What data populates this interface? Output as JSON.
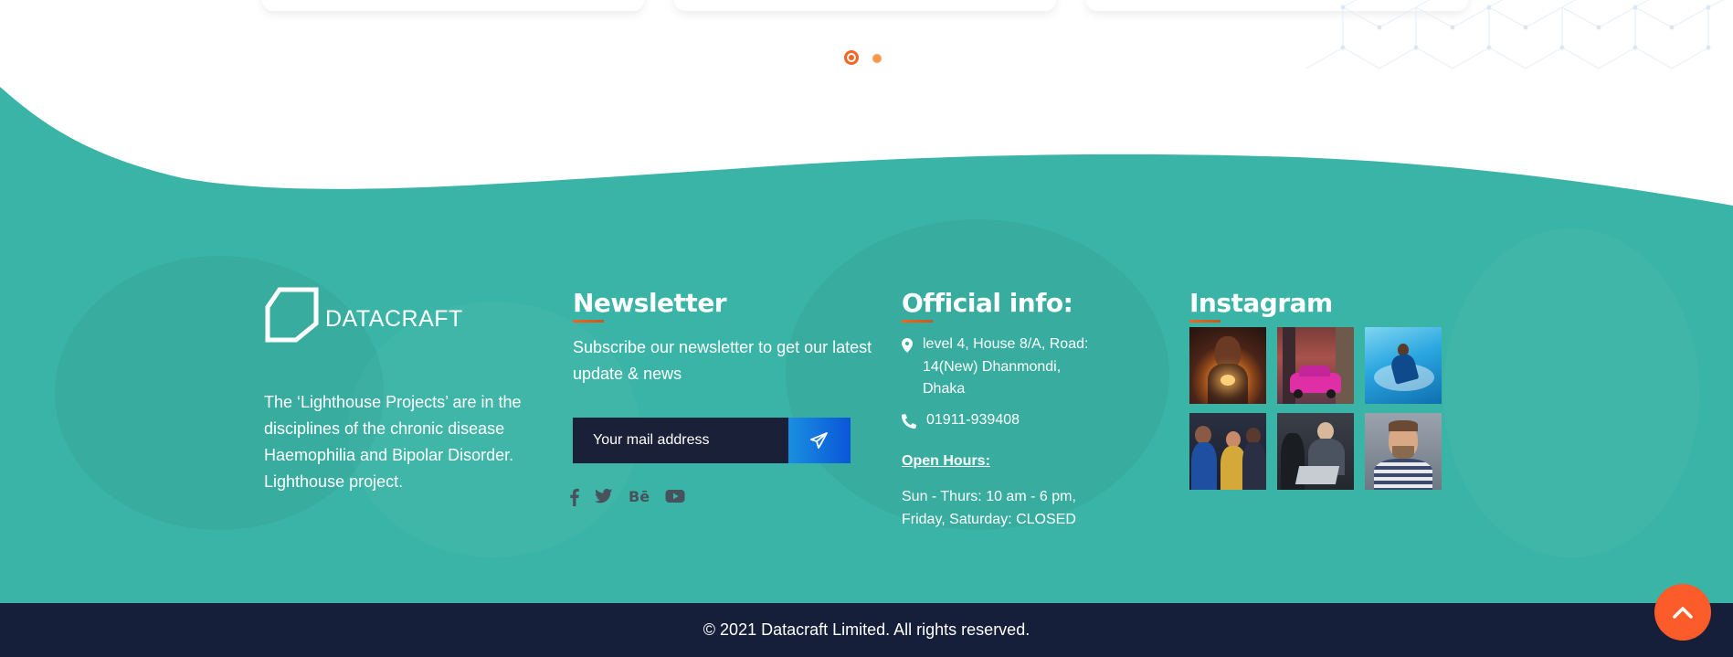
{
  "carousel": {
    "total_slides": 2,
    "active_slide": 1,
    "colors": {
      "active": "#f26522",
      "inactive": "#f79a4f"
    }
  },
  "footer": {
    "background_color": "#3ab4a6",
    "brand": {
      "logo_text": "DATACRAFT",
      "logo_icon": "hexagon-outline-icon"
    },
    "about_text": "The ‘Lighthouse Projects’ are in the disciplines of the chronic disease Haemophilia and Bipolar Disorder. Lighthouse project.",
    "newsletter": {
      "title": "Newsletter",
      "text": "Subscribe our newsletter to get our latest update & news",
      "input_placeholder": "Your mail address",
      "submit_icon": "paper-plane-icon"
    },
    "social": [
      {
        "icon": "facebook-icon",
        "label": "f"
      },
      {
        "icon": "twitter-icon",
        "label": ""
      },
      {
        "icon": "behance-icon",
        "label": "Bē"
      },
      {
        "icon": "youtube-icon",
        "label": ""
      }
    ],
    "official_info": {
      "title": "Official info:",
      "address": "level 4, House 8/A, Road: 14(New) Dhanmondi, Dhaka",
      "phone": "01911-939408",
      "open_hours_label": "Open Hours:",
      "hours_line1": "Sun - Thurs: 10 am - 6 pm,",
      "hours_line2": "Friday, Saturday: CLOSED"
    },
    "instagram": {
      "title": "Instagram",
      "photos": [
        "woman-with-lights-photo",
        "pink-vintage-car-photo",
        "woman-in-blue-water-photo",
        "group-meeting-photo",
        "people-at-laptop-photo",
        "smiling-man-photo"
      ]
    }
  },
  "copyright": "© 2021 Datacraft Limited. All rights reserved.",
  "accent_color": "#fb5c2a",
  "bottom_bar_color": "#161f3a"
}
